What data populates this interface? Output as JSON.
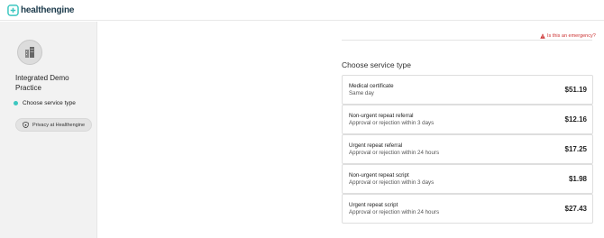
{
  "brand": {
    "name": "healthengine",
    "color": "#1b3a4b",
    "accent": "#3cc7c0"
  },
  "practice": {
    "name": "Integrated Demo Practice"
  },
  "sidebar": {
    "steps": [
      {
        "label": "Choose service type",
        "active": true
      }
    ],
    "privacy_label": "Privacy at Healthengine"
  },
  "emergency": {
    "label": "Is this an emergency?",
    "color": "#cc3333"
  },
  "main": {
    "section_title": "Choose service type",
    "services": [
      {
        "name": "Medical certificate",
        "desc": "Same day",
        "price": "$51.19"
      },
      {
        "name": "Non-urgent repeat referral",
        "desc": "Approval or rejection within 3 days",
        "price": "$12.16"
      },
      {
        "name": "Urgent repeat referral",
        "desc": "Approval or rejection within 24 hours",
        "price": "$17.25"
      },
      {
        "name": "Non-urgent repeat script",
        "desc": "Approval or rejection within 3 days",
        "price": "$1.98"
      },
      {
        "name": "Urgent repeat script",
        "desc": "Approval or rejection within 24 hours",
        "price": "$27.43"
      }
    ]
  }
}
